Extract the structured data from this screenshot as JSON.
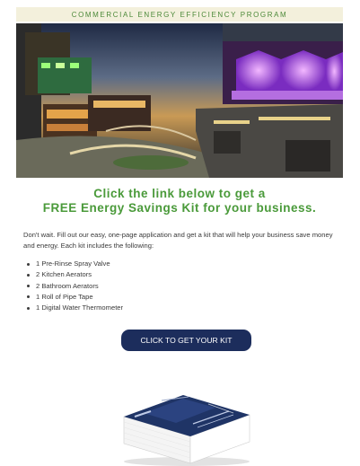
{
  "banner": {
    "text": "COMMERCIAL ENERGY EFFICIENCY PROGRAM"
  },
  "headline": {
    "line1": "Click the link below to get a",
    "line2": "FREE Energy Savings Kit for your business."
  },
  "intro": {
    "text": "Don't wait. Fill out our easy, one-page application and get a kit that will help your business save money and energy. Each kit includes the following:"
  },
  "kit_items": [
    "1 Pre-Rinse Spray Valve",
    "2 Kitchen Aerators",
    "2 Bathroom Aerators",
    "1 Roll of Pipe Tape",
    "1 Digital Water Thermometer"
  ],
  "cta": {
    "label": "CLICK TO GET YOUR KIT"
  },
  "colors": {
    "banner_bg": "#f3f0dc",
    "accent_green": "#4a9a3a",
    "button_navy": "#1c2d5c",
    "kit_box_navy": "#1f3466"
  }
}
